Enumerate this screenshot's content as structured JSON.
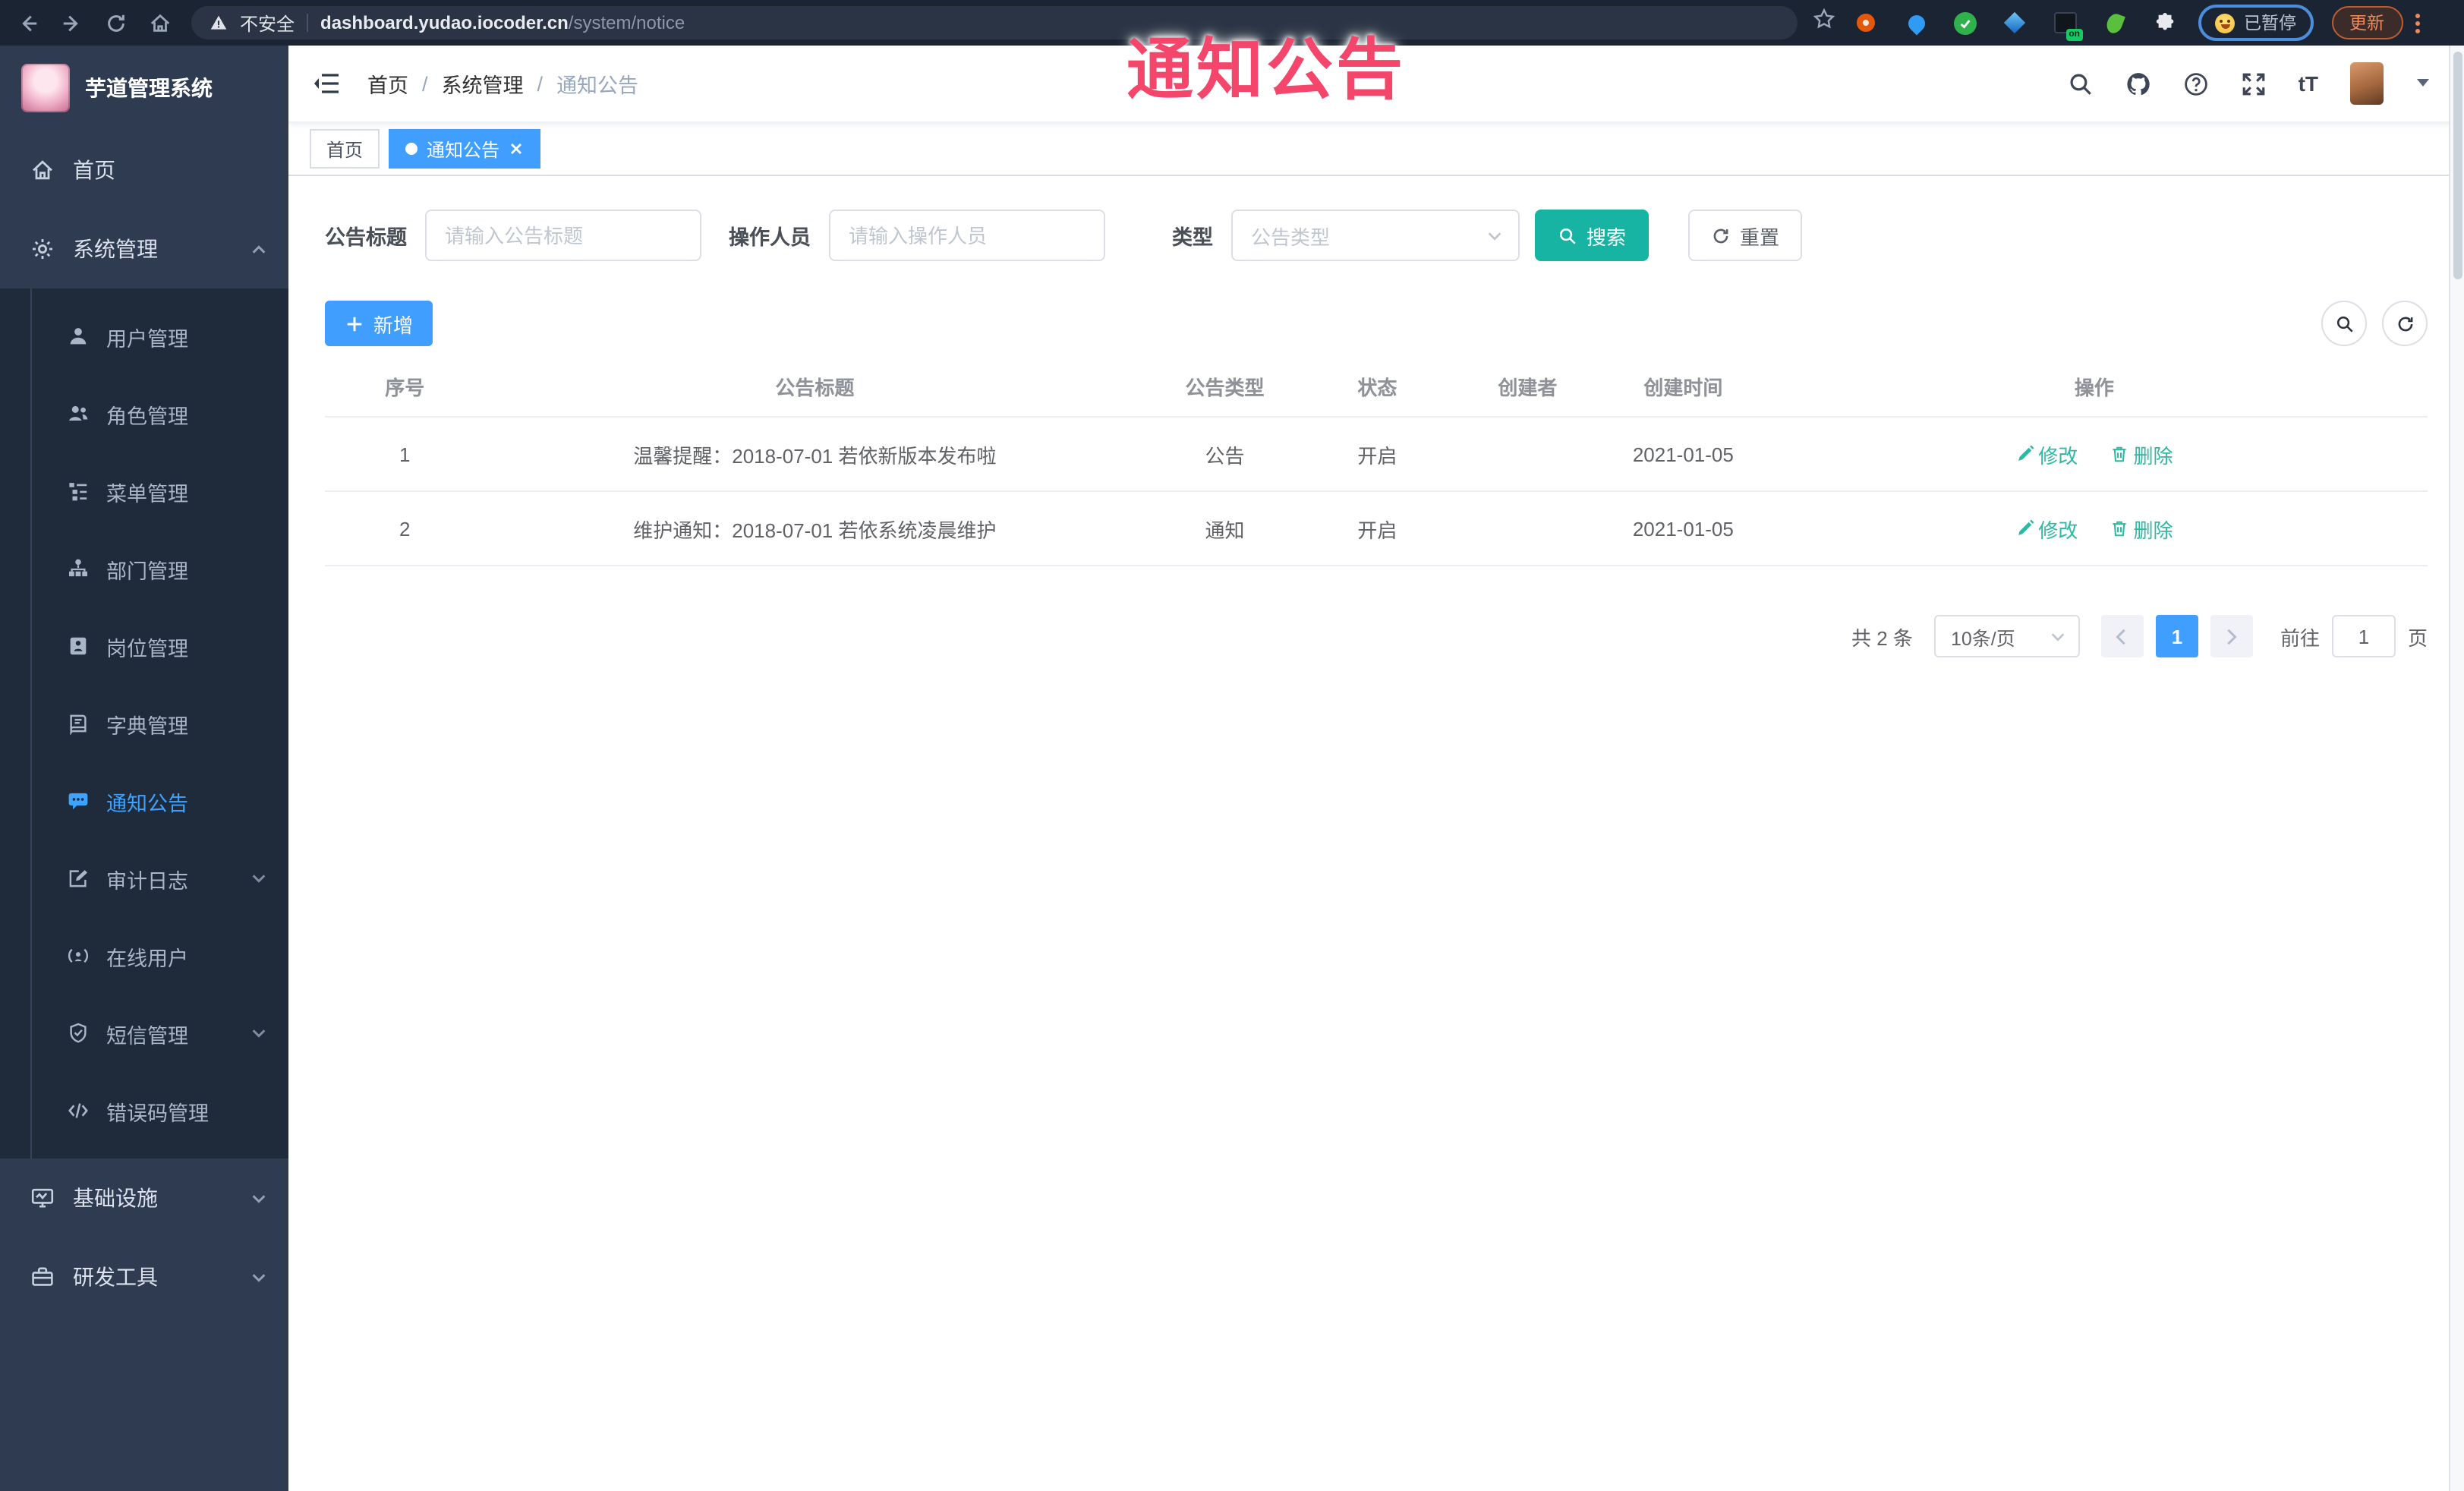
{
  "browser": {
    "security_label": "不安全",
    "url_host": "dashboard.yudao.iocoder.cn",
    "url_path": "/system/notice",
    "extension_on_badge": "on",
    "paused_label": "已暂停",
    "update_label": "更新"
  },
  "watermark": "通知公告",
  "colors": {
    "primary": "#409eff",
    "search_teal": "#17b3a3",
    "op_link": "#2fb8a3",
    "watermark_pink": "#f4456b",
    "sidebar_bg": "#2e3b50",
    "submenu_bg": "#1f2a3a",
    "browser_bg": "#1b2433",
    "active_menu": "#3ea2ff"
  },
  "sidebar": {
    "logo_title": "芋道管理系统",
    "home": "首页",
    "system": "系统管理",
    "system_children": [
      {
        "label": "用户管理"
      },
      {
        "label": "角色管理"
      },
      {
        "label": "菜单管理"
      },
      {
        "label": "部门管理"
      },
      {
        "label": "岗位管理"
      },
      {
        "label": "字典管理"
      },
      {
        "label": "通知公告",
        "active": true
      },
      {
        "label": "审计日志",
        "expandable": true
      },
      {
        "label": "在线用户"
      },
      {
        "label": "短信管理",
        "expandable": true
      },
      {
        "label": "错误码管理"
      }
    ],
    "infra": "基础设施",
    "dev_tools": "研发工具"
  },
  "header": {
    "breadcrumb": [
      "首页",
      "系统管理",
      "通知公告"
    ],
    "font_icon_label": "tT"
  },
  "tabs": [
    {
      "label": "首页",
      "active": false
    },
    {
      "label": "通知公告",
      "active": true
    }
  ],
  "filters": {
    "title_label": "公告标题",
    "title_placeholder": "请输入公告标题",
    "operator_label": "操作人员",
    "operator_placeholder": "请输入操作人员",
    "type_label": "类型",
    "type_placeholder": "公告类型",
    "search_label": "搜索",
    "reset_label": "重置"
  },
  "toolbar": {
    "add_label": "新增"
  },
  "table": {
    "columns": [
      "序号",
      "公告标题",
      "公告类型",
      "状态",
      "创建者",
      "创建时间",
      "操作"
    ],
    "ops": {
      "edit": "修改",
      "delete": "删除"
    },
    "rows": [
      {
        "no": "1",
        "title": "温馨提醒：2018-07-01 若依新版本发布啦",
        "type": "公告",
        "status": "开启",
        "creator": "",
        "create_time": "2021-01-05"
      },
      {
        "no": "2",
        "title": "维护通知：2018-07-01 若依系统凌晨维护",
        "type": "通知",
        "status": "开启",
        "creator": "",
        "create_time": "2021-01-05"
      }
    ]
  },
  "pagination": {
    "total": "共 2 条",
    "page_size": "10条/页",
    "current_page": "1",
    "goto_label": "前往",
    "goto_value": "1",
    "page_suffix": "页"
  }
}
